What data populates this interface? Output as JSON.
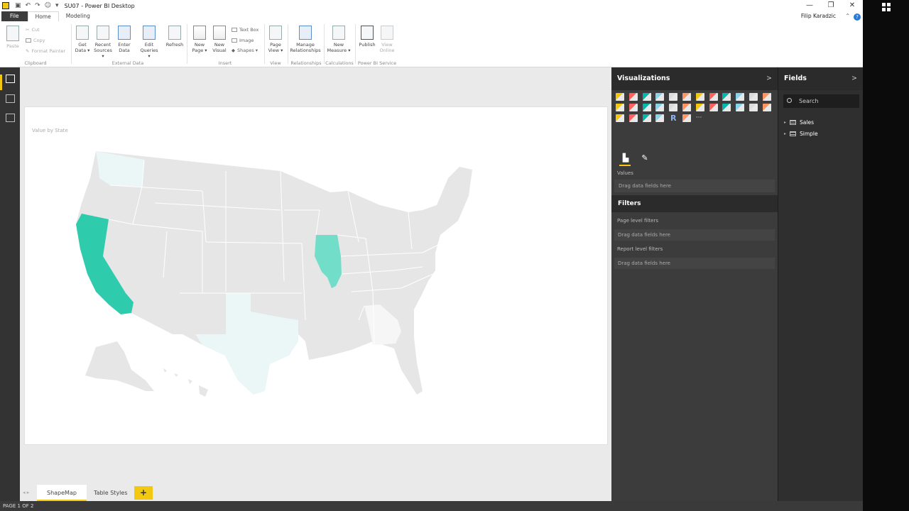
{
  "window": {
    "title": "SU07 - Power BI Desktop",
    "user": "Filip Karadzic",
    "controls": [
      "—",
      "❐",
      "✕"
    ]
  },
  "ribbon_tabs": [
    "File",
    "Home",
    "Modeling"
  ],
  "ribbon": {
    "clipboard": {
      "paste": "Paste",
      "cut": "Cut",
      "copy": "Copy",
      "format_painter": "Format Painter",
      "group": "Clipboard"
    },
    "external_data": {
      "get_data": "Get Data ▾",
      "recent_sources": "Recent Sources ▾",
      "enter_data": "Enter Data",
      "edit_queries": "Edit Queries ▾",
      "refresh": "Refresh",
      "group": "External Data"
    },
    "insert": {
      "new_page": "New Page ▾",
      "new_visual": "New Visual",
      "text_box": "Text Box",
      "image": "Image",
      "shapes": "Shapes ▾",
      "group": "Insert"
    },
    "view": {
      "page_view": "Page View ▾",
      "group": "View"
    },
    "relationships": {
      "manage": "Manage Relationships",
      "group": "Relationships"
    },
    "calculations": {
      "new_measure": "New Measure ▾",
      "group": "Calculations"
    },
    "service": {
      "publish": "Publish",
      "view_online": "View Online",
      "group": "Power BI Service"
    }
  },
  "visual": {
    "title": "Value by State"
  },
  "map": {
    "colors": {
      "base": "#e6e6e6",
      "strong": "#2ecbad",
      "medium": "#72ddc9",
      "light": "#eaf7f6",
      "faint": "#f6f6f6"
    }
  },
  "page_tabs": {
    "tabs": [
      "ShapeMap",
      "Table Styles"
    ],
    "add": "+",
    "nav": "◂ ▸"
  },
  "status": "PAGE 1 OF 2",
  "visualizations": {
    "title": "Visualizations",
    "chevron": ">",
    "values_label": "Values",
    "values_drop": "Drag data fields here"
  },
  "filters": {
    "title": "Filters",
    "page_level": "Page level filters",
    "page_drop": "Drag data fields here",
    "report_level": "Report level filters",
    "report_drop": "Drag data fields here"
  },
  "fields": {
    "title": "Fields",
    "chevron": ">",
    "search_placeholder": "Search",
    "tables": [
      "Sales",
      "Simple"
    ]
  }
}
